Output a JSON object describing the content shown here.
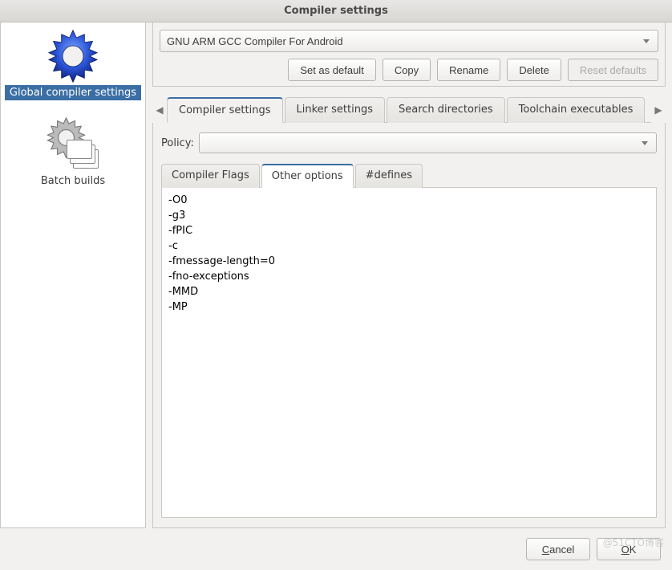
{
  "window": {
    "title": "Compiler settings"
  },
  "sidebar": {
    "items": [
      {
        "label": "Global compiler settings"
      },
      {
        "label": "Batch builds"
      }
    ]
  },
  "compiler_select": {
    "value": "GNU ARM GCC Compiler For Android"
  },
  "actions": {
    "set_default": "Set as default",
    "copy": "Copy",
    "rename": "Rename",
    "delete": "Delete",
    "reset": "Reset defaults"
  },
  "main_tabs": [
    {
      "label": "Compiler settings"
    },
    {
      "label": "Linker settings"
    },
    {
      "label": "Search directories"
    },
    {
      "label": "Toolchain executables"
    }
  ],
  "policy": {
    "label": "Policy:",
    "value": ""
  },
  "sub_tabs": [
    {
      "label": "Compiler Flags"
    },
    {
      "label": "Other options"
    },
    {
      "label": "#defines"
    }
  ],
  "other_options_text": "-O0\n-g3\n-fPIC\n-c\n-fmessage-length=0\n-fno-exceptions\n-MMD\n-MP\n",
  "footer": {
    "cancel": "Cancel",
    "ok": "OK"
  },
  "watermark": "@51CTO博客"
}
